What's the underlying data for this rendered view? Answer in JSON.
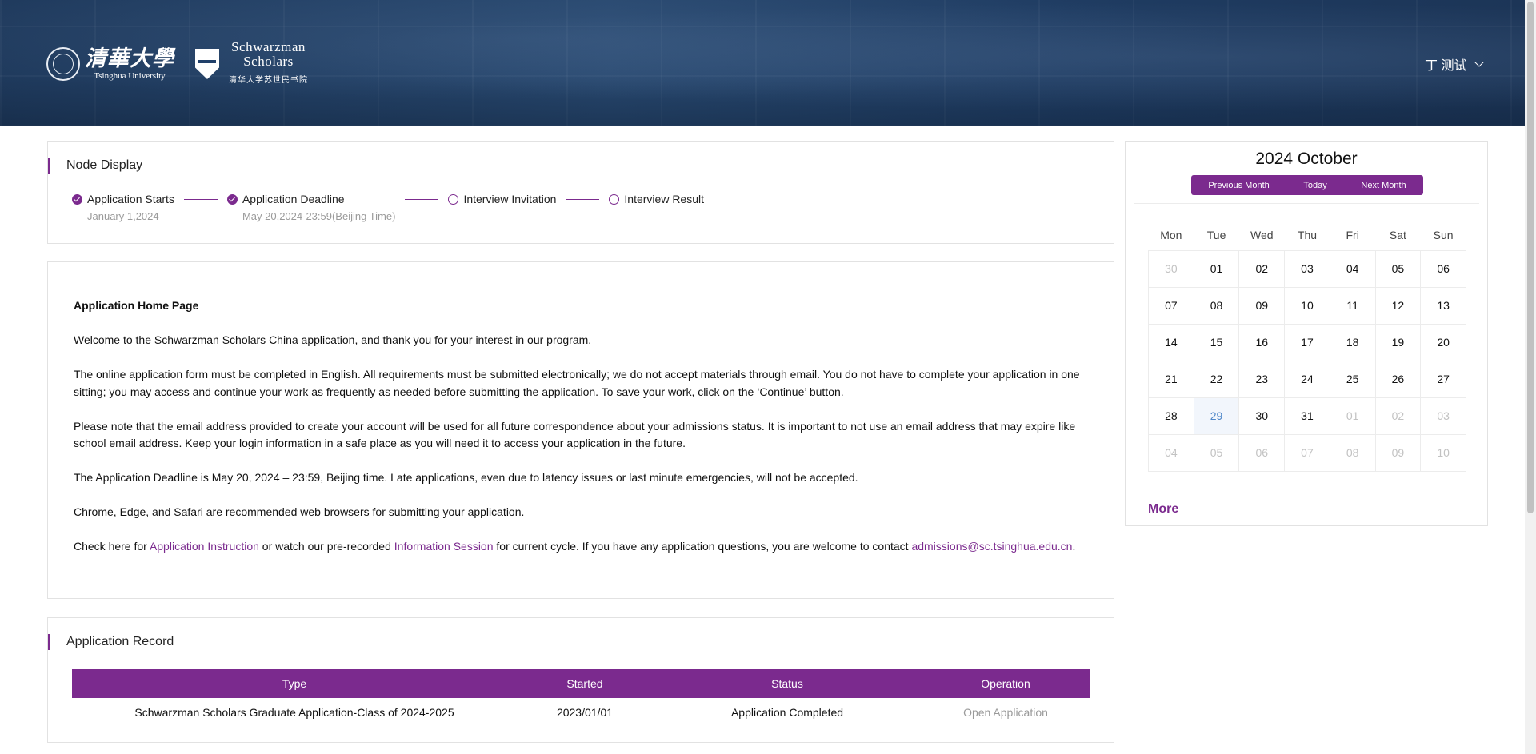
{
  "header": {
    "tsinghua_cn": "清華大學",
    "tsinghua_en": "Tsinghua University",
    "ss_line1": "Schwarzman",
    "ss_line2": "Scholars",
    "ss_cn": "清华大学苏世民书院",
    "user_name": "丁 测试"
  },
  "node_display": {
    "title": "Node Display",
    "steps": [
      {
        "label": "Application Starts",
        "date": "January 1,2024",
        "done": true
      },
      {
        "label": "Application Deadline",
        "date": "May 20,2024-23:59(Beijing Time)",
        "done": true
      },
      {
        "label": "Interview Invitation",
        "date": "",
        "done": false
      },
      {
        "label": "Interview Result",
        "date": "",
        "done": false
      }
    ]
  },
  "home": {
    "title": "Application Home Page",
    "p1": "Welcome to the Schwarzman Scholars China application, and thank you for your interest in our program.",
    "p2": "The online application form must be completed in English. All requirements must be submitted electronically; we do not accept materials through email. You do not have to complete your application in one sitting; you may access and continue your work as frequently as needed before submitting the application. To save your work, click on the ‘Continue’ button.",
    "p3": "Please note that the email address provided to create your account will be used for all future correspondence about your admissions status. It is important to not use an email address that may expire like school email address. Keep your login information in a safe place as you will need it to access your application in the future.",
    "p4": "The Application Deadline is May 20, 2024 – 23:59, Beijing time. Late applications, even due to latency issues or last minute emergencies, will not be accepted.",
    "p5": "Chrome, Edge, and Safari are recommended web browsers for submitting your application.",
    "p6_a": "Check here for ",
    "p6_link1": "Application Instruction",
    "p6_b": " or watch our pre-recorded ",
    "p6_link2": "Information Session",
    "p6_c": " for current cycle. If you have any application questions, you are welcome to contact ",
    "p6_email": "admissions@sc.tsinghua.edu.cn",
    "p6_d": "."
  },
  "record": {
    "title": "Application Record",
    "columns": [
      "Type",
      "Started",
      "Status",
      "Operation"
    ],
    "rows": [
      {
        "type": "Schwarzman Scholars Graduate Application-Class of 2024-2025",
        "started": "2023/01/01",
        "status": "Application Completed",
        "operation": "Open Application"
      }
    ]
  },
  "calendar": {
    "title": "2024 October",
    "prev_label": "Previous Month",
    "today_label": "Today",
    "next_label": "Next Month",
    "weekdays": [
      "Mon",
      "Tue",
      "Wed",
      "Thu",
      "Fri",
      "Sat",
      "Sun"
    ],
    "weeks": [
      [
        "30",
        "01",
        "02",
        "03",
        "04",
        "05",
        "06"
      ],
      [
        "07",
        "08",
        "09",
        "10",
        "11",
        "12",
        "13"
      ],
      [
        "14",
        "15",
        "16",
        "17",
        "18",
        "19",
        "20"
      ],
      [
        "21",
        "22",
        "23",
        "24",
        "25",
        "26",
        "27"
      ],
      [
        "28",
        "29",
        "30",
        "31",
        "01",
        "02",
        "03"
      ],
      [
        "04",
        "05",
        "06",
        "07",
        "08",
        "09",
        "10"
      ]
    ],
    "more_label": "More"
  }
}
